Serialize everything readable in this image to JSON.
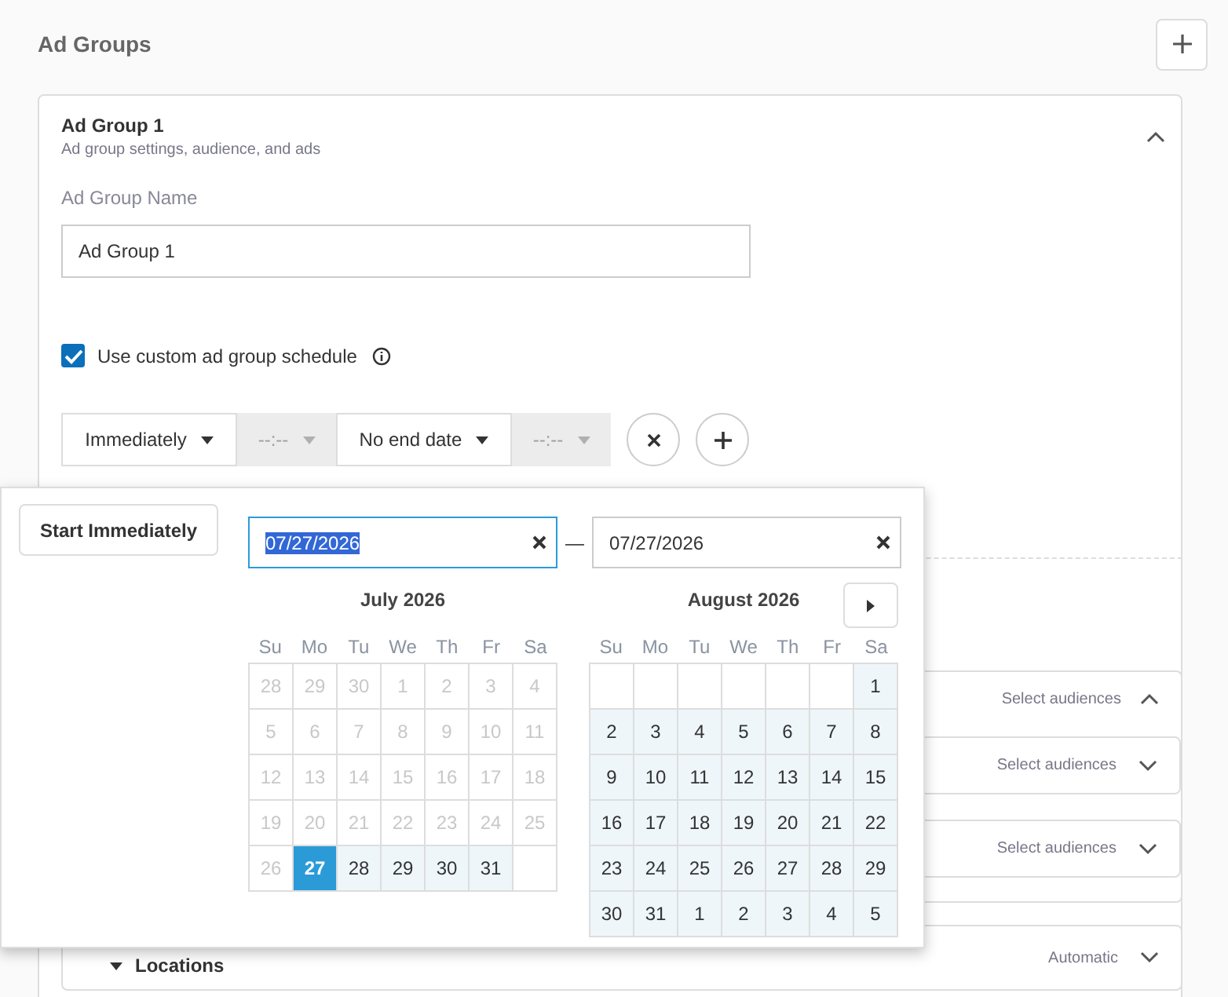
{
  "section": {
    "title": "Ad Groups"
  },
  "ad_group": {
    "title": "Ad Group 1",
    "subtitle": "Ad group settings, audience, and ads",
    "expanded": true,
    "name_label": "Ad Group Name",
    "name_value": "Ad Group 1",
    "custom_schedule": {
      "label": "Use custom ad group schedule",
      "checked": true
    },
    "schedule": [
      {
        "text": "Immediately",
        "disabled": false
      },
      {
        "text": "--:--",
        "disabled": true
      },
      {
        "text": "No end date",
        "disabled": false
      },
      {
        "text": "--:--",
        "disabled": true
      }
    ],
    "audiences": {
      "summary": "Select audiences",
      "expanded": true,
      "rows": [
        {
          "summary": "Select audiences",
          "expanded": false
        },
        {
          "summary": "Select audiences",
          "expanded": false
        }
      ]
    },
    "locations": {
      "label": "Locations",
      "summary": "Automatic",
      "expanded": false
    }
  },
  "date_picker": {
    "start_immediately": "Start Immediately",
    "start_date": "07/27/2026",
    "start_selected": true,
    "separator": "—",
    "end_date": "07/27/2026",
    "months": [
      {
        "title": "July 2026",
        "weekdays": [
          "Su",
          "Mo",
          "Tu",
          "We",
          "Th",
          "Fr",
          "Sa"
        ],
        "days": [
          {
            "label": "28",
            "kind": "disabled"
          },
          {
            "label": "29",
            "kind": "disabled"
          },
          {
            "label": "30",
            "kind": "disabled"
          },
          {
            "label": "1",
            "kind": "disabled"
          },
          {
            "label": "2",
            "kind": "disabled"
          },
          {
            "label": "3",
            "kind": "disabled"
          },
          {
            "label": "4",
            "kind": "disabled"
          },
          {
            "label": "5",
            "kind": "disabled"
          },
          {
            "label": "6",
            "kind": "disabled"
          },
          {
            "label": "7",
            "kind": "disabled"
          },
          {
            "label": "8",
            "kind": "disabled"
          },
          {
            "label": "9",
            "kind": "disabled"
          },
          {
            "label": "10",
            "kind": "disabled"
          },
          {
            "label": "11",
            "kind": "disabled"
          },
          {
            "label": "12",
            "kind": "disabled"
          },
          {
            "label": "13",
            "kind": "disabled"
          },
          {
            "label": "14",
            "kind": "disabled"
          },
          {
            "label": "15",
            "kind": "disabled"
          },
          {
            "label": "16",
            "kind": "disabled"
          },
          {
            "label": "17",
            "kind": "disabled"
          },
          {
            "label": "18",
            "kind": "disabled"
          },
          {
            "label": "19",
            "kind": "disabled"
          },
          {
            "label": "20",
            "kind": "disabled"
          },
          {
            "label": "21",
            "kind": "disabled"
          },
          {
            "label": "22",
            "kind": "disabled"
          },
          {
            "label": "23",
            "kind": "disabled"
          },
          {
            "label": "24",
            "kind": "disabled"
          },
          {
            "label": "25",
            "kind": "disabled"
          },
          {
            "label": "26",
            "kind": "disabled"
          },
          {
            "label": "27",
            "kind": "selected"
          },
          {
            "label": "28",
            "kind": "range"
          },
          {
            "label": "29",
            "kind": "range"
          },
          {
            "label": "30",
            "kind": "range"
          },
          {
            "label": "31",
            "kind": "range"
          },
          {
            "kind": "blank"
          }
        ]
      },
      {
        "title": "August 2026",
        "weekdays": [
          "Su",
          "Mo",
          "Tu",
          "We",
          "Th",
          "Fr",
          "Sa"
        ],
        "days": [
          {
            "kind": "blank"
          },
          {
            "kind": "blank"
          },
          {
            "kind": "blank"
          },
          {
            "kind": "blank"
          },
          {
            "kind": "blank"
          },
          {
            "kind": "blank"
          },
          {
            "label": "1",
            "kind": "range"
          },
          {
            "label": "2",
            "kind": "range"
          },
          {
            "label": "3",
            "kind": "range"
          },
          {
            "label": "4",
            "kind": "range"
          },
          {
            "label": "5",
            "kind": "range"
          },
          {
            "label": "6",
            "kind": "range"
          },
          {
            "label": "7",
            "kind": "range"
          },
          {
            "label": "8",
            "kind": "range"
          },
          {
            "label": "9",
            "kind": "range"
          },
          {
            "label": "10",
            "kind": "range"
          },
          {
            "label": "11",
            "kind": "range"
          },
          {
            "label": "12",
            "kind": "range"
          },
          {
            "label": "13",
            "kind": "range"
          },
          {
            "label": "14",
            "kind": "range"
          },
          {
            "label": "15",
            "kind": "range"
          },
          {
            "label": "16",
            "kind": "range"
          },
          {
            "label": "17",
            "kind": "range"
          },
          {
            "label": "18",
            "kind": "range"
          },
          {
            "label": "19",
            "kind": "range"
          },
          {
            "label": "20",
            "kind": "range"
          },
          {
            "label": "21",
            "kind": "range"
          },
          {
            "label": "22",
            "kind": "range"
          },
          {
            "label": "23",
            "kind": "range"
          },
          {
            "label": "24",
            "kind": "range"
          },
          {
            "label": "25",
            "kind": "range"
          },
          {
            "label": "26",
            "kind": "range"
          },
          {
            "label": "27",
            "kind": "range"
          },
          {
            "label": "28",
            "kind": "range"
          },
          {
            "label": "29",
            "kind": "range"
          },
          {
            "label": "30",
            "kind": "range"
          },
          {
            "label": "31",
            "kind": "range"
          },
          {
            "label": "1",
            "kind": "range"
          },
          {
            "label": "2",
            "kind": "range"
          },
          {
            "label": "3",
            "kind": "range"
          },
          {
            "label": "4",
            "kind": "range"
          },
          {
            "label": "5",
            "kind": "range"
          }
        ]
      }
    ]
  }
}
